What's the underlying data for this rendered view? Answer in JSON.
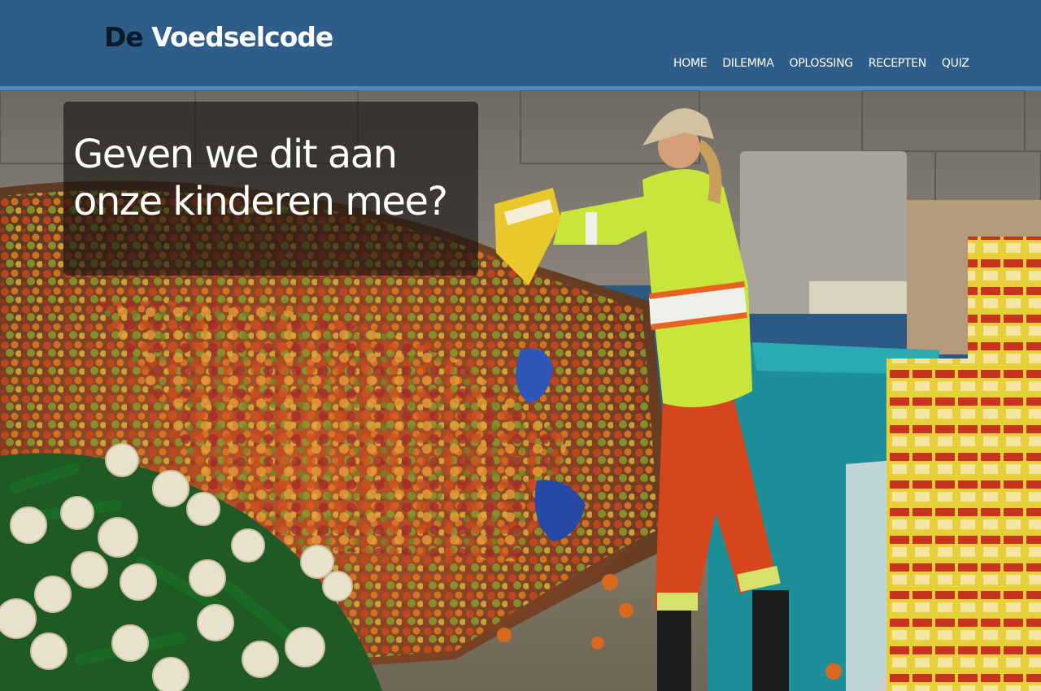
{
  "brand": {
    "prefix": "De",
    "name": "Voedselcode"
  },
  "nav": {
    "items": [
      {
        "label": "HOME"
      },
      {
        "label": "DILEMMA"
      },
      {
        "label": "OPLOSSING"
      },
      {
        "label": "RECEPTEN"
      },
      {
        "label": "QUIZ"
      }
    ]
  },
  "hero": {
    "heading": "Geven we dit aan onze kinderen mee?"
  },
  "colors": {
    "header": "#2d5d88",
    "header_stripe": "#4a8ac4",
    "logo_prefix": "#0b1a2a",
    "logo_main": "#ffffff"
  }
}
